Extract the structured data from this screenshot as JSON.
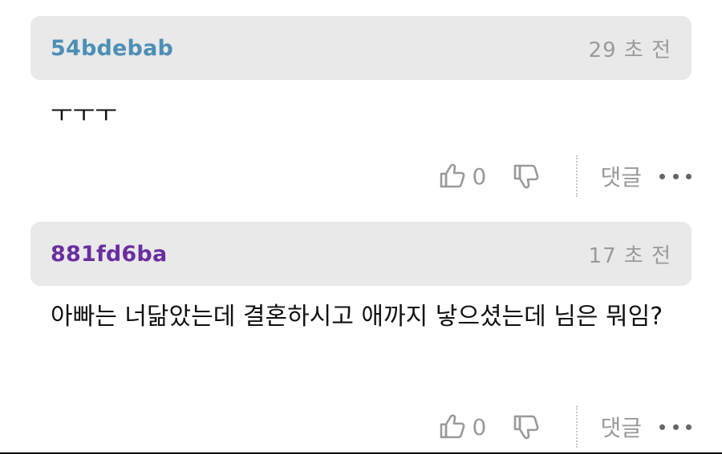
{
  "comments": [
    {
      "username": "54bdebab",
      "username_color": "#4d8fb5",
      "timestamp": "29 초 전",
      "text": "ㅜㅜㅜ",
      "like_count": "0",
      "reply_label": "댓글"
    },
    {
      "username": "881fd6ba",
      "username_color": "#6a2ea0",
      "timestamp": "17 초 전",
      "text": "아빠는 너닮았는데 결혼하시고 애까지 낳으셨는데 님은 뭐임?",
      "like_count": "0",
      "reply_label": "댓글"
    }
  ],
  "icons": {
    "like": "thumbs-up-icon",
    "dislike": "thumbs-down-icon",
    "more": "more-dots-icon"
  },
  "colors": {
    "header_bg": "#e9e9e9",
    "muted_text": "#9a9a9a",
    "body_text": "#111111"
  }
}
